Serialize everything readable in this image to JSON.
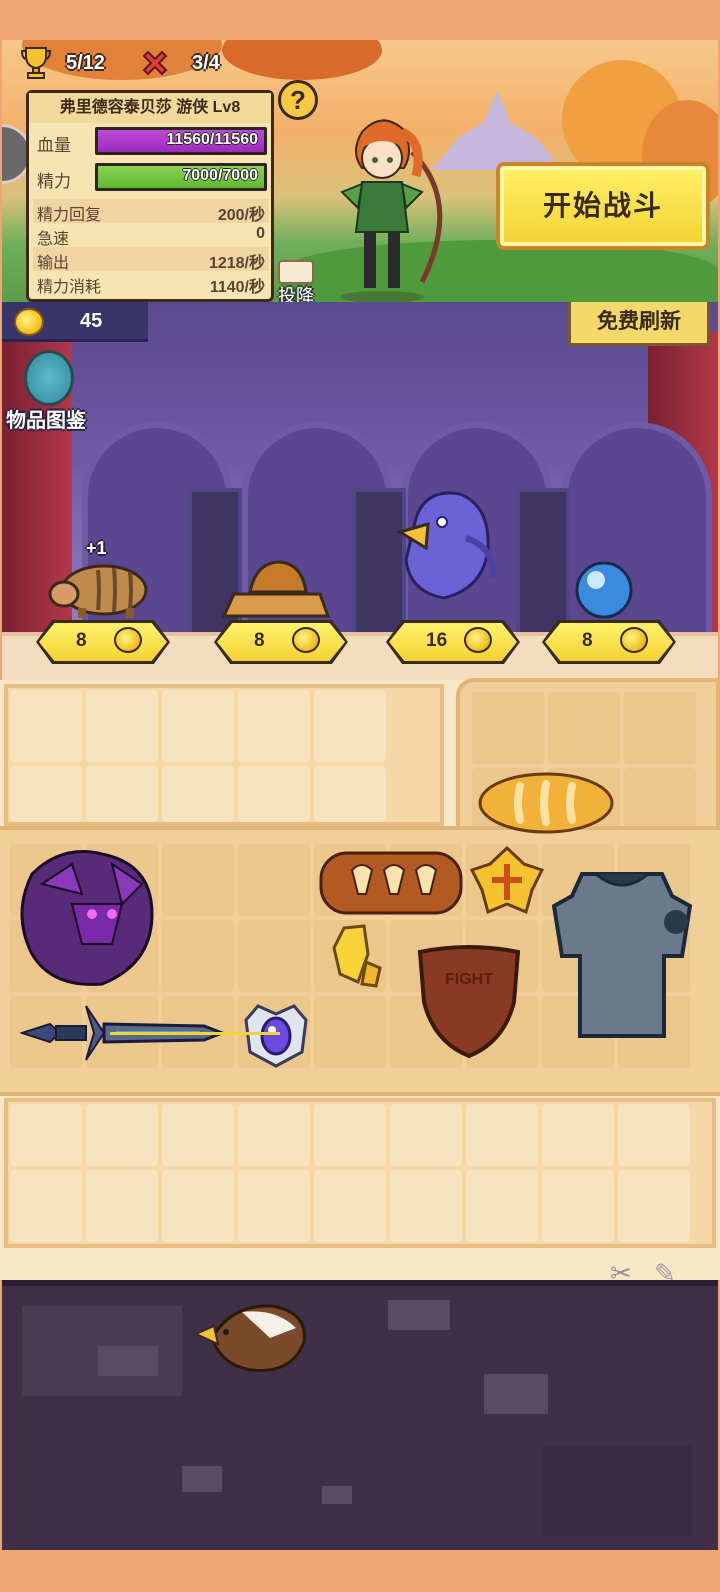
{
  "header": {
    "wins": "5/12",
    "losses": "3/4"
  },
  "hero": {
    "name_line": "弗里德容泰贝莎 游侠 Lv8",
    "hp_label": "血量",
    "hp_value": "11560/11560",
    "sp_label": "精力",
    "sp_value": "7000/7000",
    "stats": [
      {
        "label": "精力回复",
        "value": "200/秒"
      },
      {
        "label": "急速",
        "value": "0"
      },
      {
        "label": "输出",
        "value": "1218/秒"
      },
      {
        "label": "精力消耗",
        "value": "1140/秒"
      }
    ]
  },
  "buttons": {
    "help": "?",
    "surrender": "投降",
    "start_battle": "开始战斗",
    "free_refresh": "免费刷新",
    "codex": "物品图鉴"
  },
  "shop": {
    "coins": "45",
    "items": [
      {
        "name": "boar-pet",
        "price": "8",
        "badge": "+1"
      },
      {
        "name": "straw-hat",
        "price": "8"
      },
      {
        "name": "blue-bird",
        "price": "16"
      },
      {
        "name": "water-orb",
        "price": "8"
      }
    ]
  },
  "inventory": {
    "items": [
      "dragon",
      "bread",
      "pastry-tray",
      "gold-emblem",
      "chain-armor",
      "yellow-crystal",
      "leather-shield",
      "dark-sword",
      "eye-orb"
    ],
    "shield_text": "FIGHT"
  },
  "discard": {
    "items": [
      "eagle-head"
    ]
  },
  "colors": {
    "accent_yellow": "#f4d330",
    "hp_purple": "#b03ad0",
    "sp_green": "#6cc23a",
    "frame_orange": "#f0a574"
  },
  "icons": [
    "trophy-icon",
    "red-x-icon",
    "help-icon",
    "coin-icon",
    "codex-book-icon",
    "scroll-icon",
    "scissors-icon"
  ]
}
